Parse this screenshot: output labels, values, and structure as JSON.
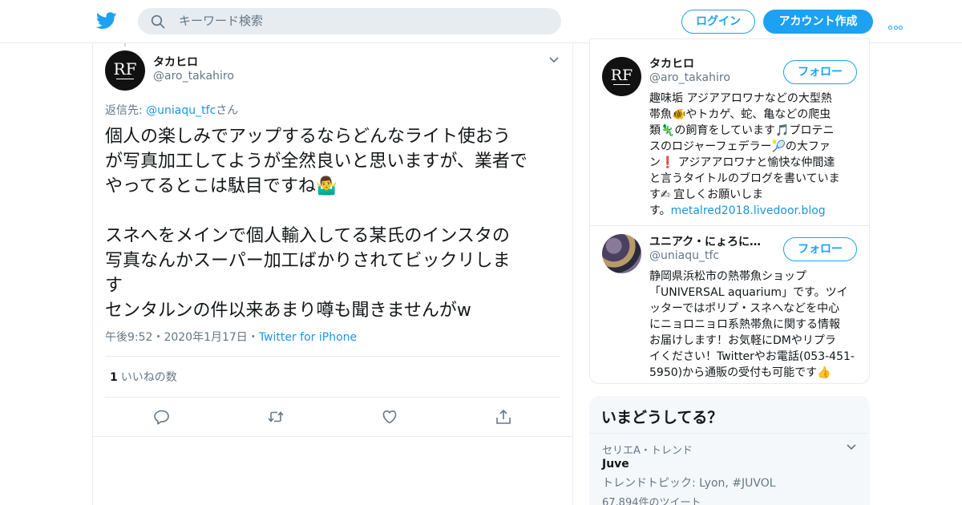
{
  "header": {
    "search_placeholder": "キーワード検索",
    "login_label": "ログイン",
    "signup_label": "アカウント作成",
    "accent_color": "#1da1f2",
    "icons": [
      "twitter-bird-icon",
      "search-icon",
      "more-icon"
    ]
  },
  "tweet": {
    "author_name": "タカヒロ",
    "author_handle": "@aro_takahiro",
    "reply_prefix": "返信先: ",
    "reply_to": "@uniaqu_tfc",
    "reply_suffix": "さん",
    "text": "個人の楽しみでアップするならどんなライト使おう\nが写真加工してようが全然良いと思いますが、業者で\nやってるとこは駄目ですね🤷‍♂️\n\nスネへをメインで個人輸入してる某氏のインスタの\n写真なんかスーパー加工ばかりされてビックリしま\nす\nセンタルンの件以来あまり噂も聞きませんがw",
    "time": "午後9:52",
    "date": "2020年1月17日",
    "sep": "・",
    "source": "Twitter for iPhone",
    "likes_count": "1",
    "likes_label": "いいねの数",
    "actions": [
      "reply-icon",
      "retweet-icon",
      "like-icon",
      "share-icon"
    ]
  },
  "users": [
    {
      "name": "タカヒロ",
      "handle": "@aro_takahiro",
      "follow_label": "フォロー",
      "bio": "趣味垢 アジアアロワナなどの大型熱\n帯魚🐠やトカゲ、蛇、亀などの爬虫\n類🦎の飼育をしています🎵プロテニ\nスのロジャーフェデラー🎾の大ファ\nン❗ アジアアロワナと愉快な仲間達\nと言うタイトルのブログを書いていま\nす✍ 宜しくお願いしま\nす。",
      "link": "metalred2018.livedoor.blog"
    },
    {
      "name": "ユニアク・にょろに…",
      "handle": "@uniaqu_tfc",
      "follow_label": "フォロー",
      "bio": "静岡県浜松市の熱帯魚ショップ\n「UNIVERSAL aquarium」です。ツイ\nッターではポリプ・スネへなどを中心\nにニョロニョロ系熱帯魚に関する情報\nお届けします！お気軽にDMやリプラ\nイください！Twitterやお電話(053-451-\n5950)から通販の受付も可能です👍"
    }
  ],
  "trends": {
    "title": "いまどうしてる？",
    "items": [
      {
        "context": "セリエA・トレンド",
        "name": "Juve",
        "topic": "トレンドトピック: Lyon, #JUVOL",
        "count": "67,894件のツイート"
      }
    ]
  }
}
